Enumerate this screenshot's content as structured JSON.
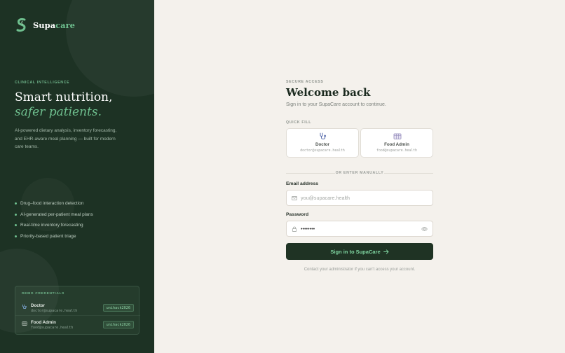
{
  "brand": {
    "name_prefix": "Supa",
    "name_suffix": "care",
    "accent_color": "#6fc08f",
    "panel_color": "#1d3224"
  },
  "hero": {
    "eyebrow": "CLINICAL INTELLIGENCE",
    "headline_line1": "Smart nutrition,",
    "headline_line2": "safer patients.",
    "description": "AI-powered dietary analysis, inventory forecasting, and EHR-aware meal planning — built for modern care teams."
  },
  "features": [
    "Drug–food interaction detection",
    "AI-generated per-patient meal plans",
    "Real-time inventory forecasting",
    "Priority-based patient triage"
  ],
  "demo_credentials": {
    "title": "DEMO CREDENTIALS",
    "accounts": [
      {
        "role": "Doctor",
        "email": "doctor@supacare.health",
        "password": "unihack2026",
        "icon": "stethoscope-icon"
      },
      {
        "role": "Food Admin",
        "email": "food@supacare.health",
        "password": "unihack2026",
        "icon": "food-tray-icon"
      }
    ]
  },
  "form": {
    "eyebrow": "SECURE ACCESS",
    "title": "Welcome back",
    "subtitle": "Sign in to your SupaCare account to continue.",
    "quick_fill_label": "QUICK FILL",
    "quick_fill": [
      {
        "role": "Doctor",
        "email": "doctor@supacare.health",
        "icon": "stethoscope-icon"
      },
      {
        "role": "Food Admin",
        "email": "food@supacare.health",
        "icon": "food-tray-icon"
      }
    ],
    "divider_text": "OR ENTER MANUALLY",
    "email_label": "Email address",
    "email_placeholder": "you@supacare.health",
    "email_value": "",
    "password_label": "Password",
    "password_value": "••••••••",
    "submit_label": "Sign in to SupaCare",
    "helper_text": "Contact your administrator if you can't access your account."
  }
}
